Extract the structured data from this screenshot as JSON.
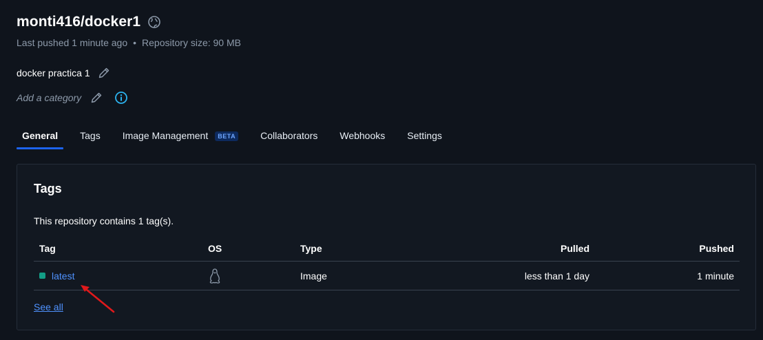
{
  "repo": {
    "title": "monti416/docker1",
    "last_pushed": "Last pushed 1 minute ago",
    "separator": "•",
    "size": "Repository size: 90 MB",
    "description": "docker practica 1",
    "category_placeholder": "Add a category"
  },
  "tabs": [
    {
      "label": "General",
      "active": true
    },
    {
      "label": "Tags"
    },
    {
      "label": "Image Management",
      "badge": "BETA"
    },
    {
      "label": "Collaborators"
    },
    {
      "label": "Webhooks"
    },
    {
      "label": "Settings"
    }
  ],
  "tags_card": {
    "title": "Tags",
    "summary": "This repository contains 1 tag(s).",
    "columns": {
      "tag": "Tag",
      "os": "OS",
      "type": "Type",
      "pulled": "Pulled",
      "pushed": "Pushed"
    },
    "rows": [
      {
        "tag": "latest",
        "os_icon": "linux-icon",
        "type": "Image",
        "pulled": "less than 1 day",
        "pushed": "1 minute"
      }
    ],
    "see_all": "See all"
  },
  "icons": {
    "public": "globe-icon",
    "edit": "pencil-icon",
    "info": "info-icon",
    "os": "linux-icon",
    "annotation": "red-arrow-annotation"
  },
  "colors": {
    "background": "#0f141c",
    "accent": "#1d63ed",
    "link": "#4f92ff",
    "tag_status": "#139d86",
    "info": "#2cb4f0",
    "annotation": "#e0191b"
  }
}
